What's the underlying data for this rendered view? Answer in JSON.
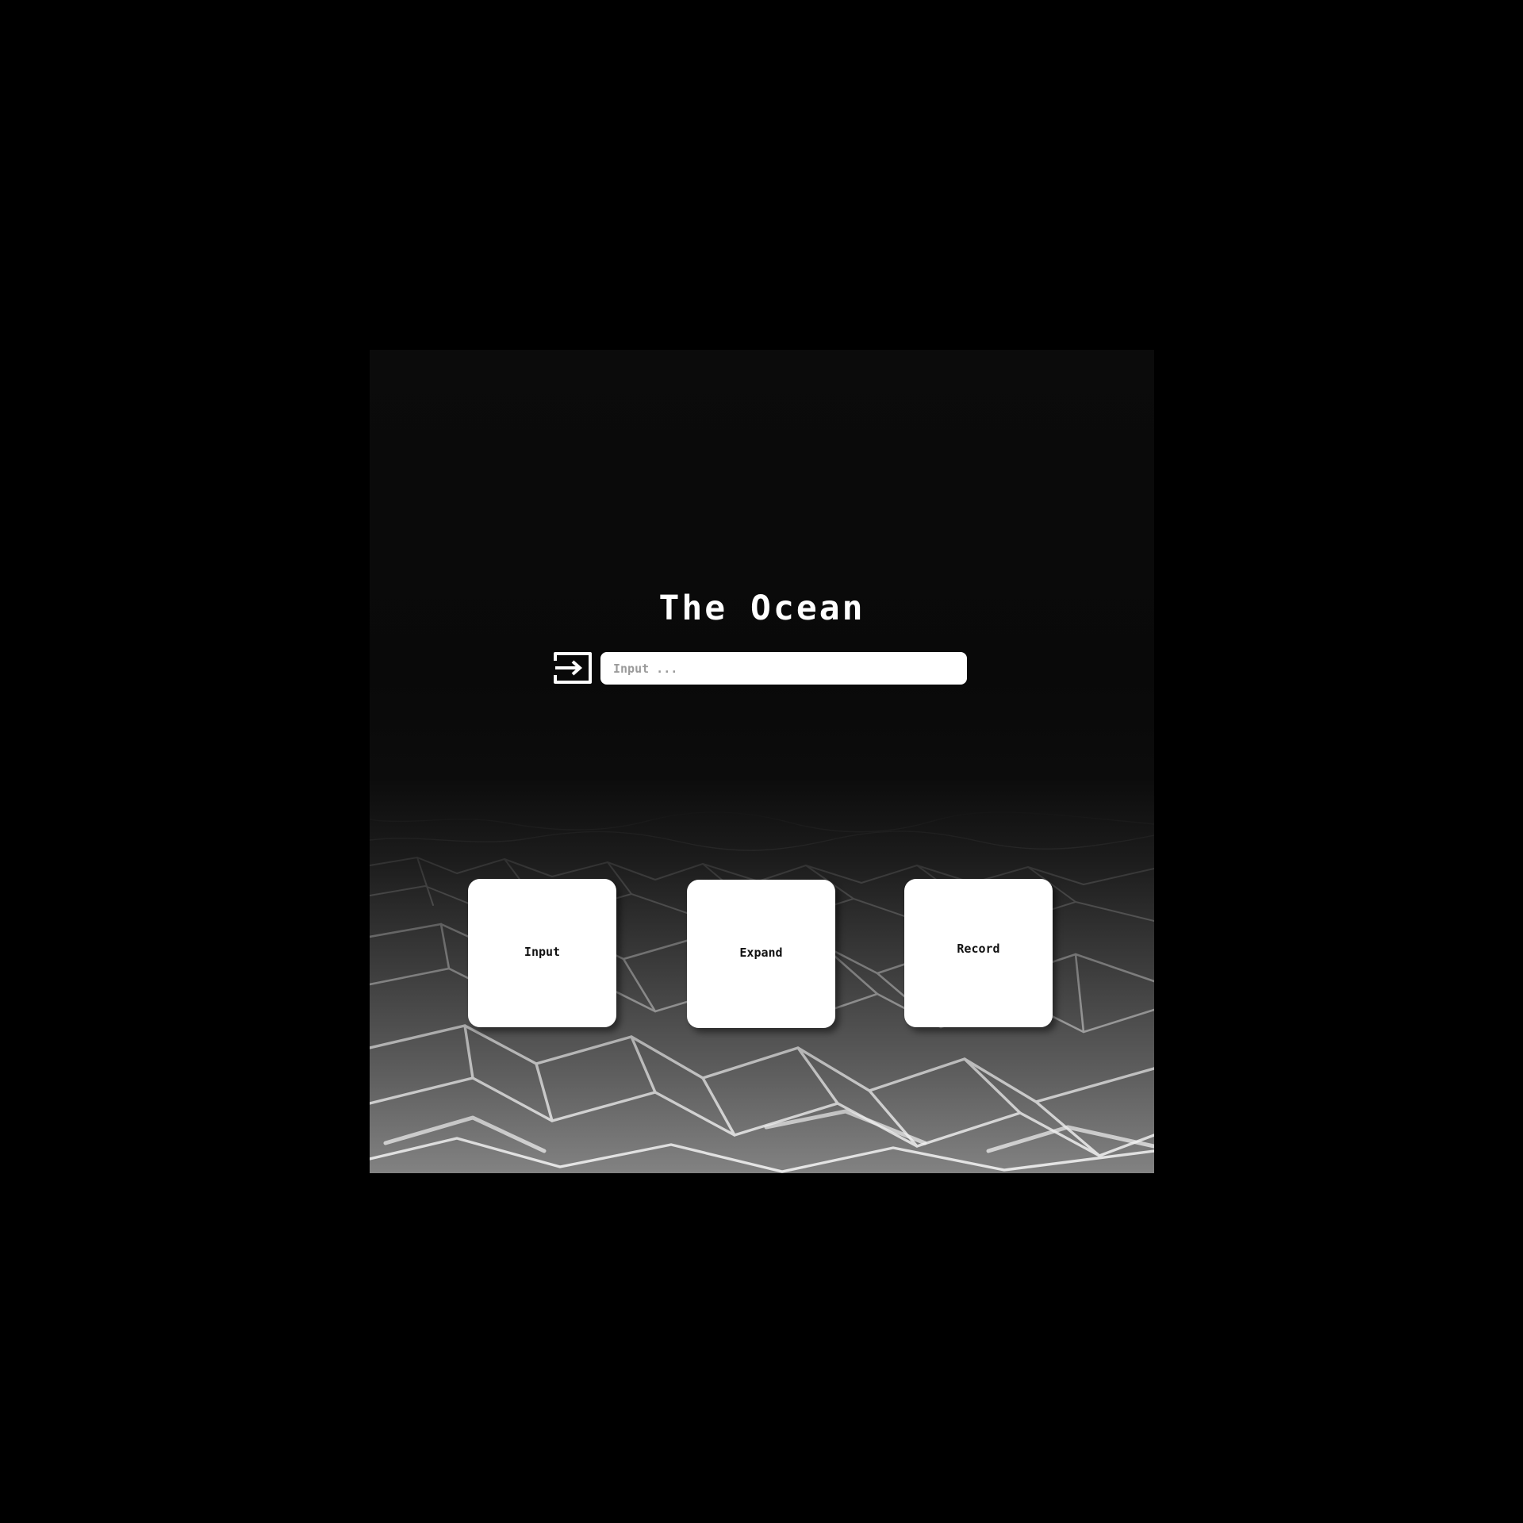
{
  "header": {
    "title": "The Ocean"
  },
  "search": {
    "placeholder": "Input ...",
    "value": "",
    "icon": "login-icon"
  },
  "cards": [
    {
      "label": "Input"
    },
    {
      "label": "Expand"
    },
    {
      "label": "Record"
    }
  ],
  "colors": {
    "page_background": "#000000",
    "card_background": "#ffffff",
    "title_text": "#ffffff",
    "card_text": "#111111",
    "placeholder_text": "#9a9a9a"
  }
}
